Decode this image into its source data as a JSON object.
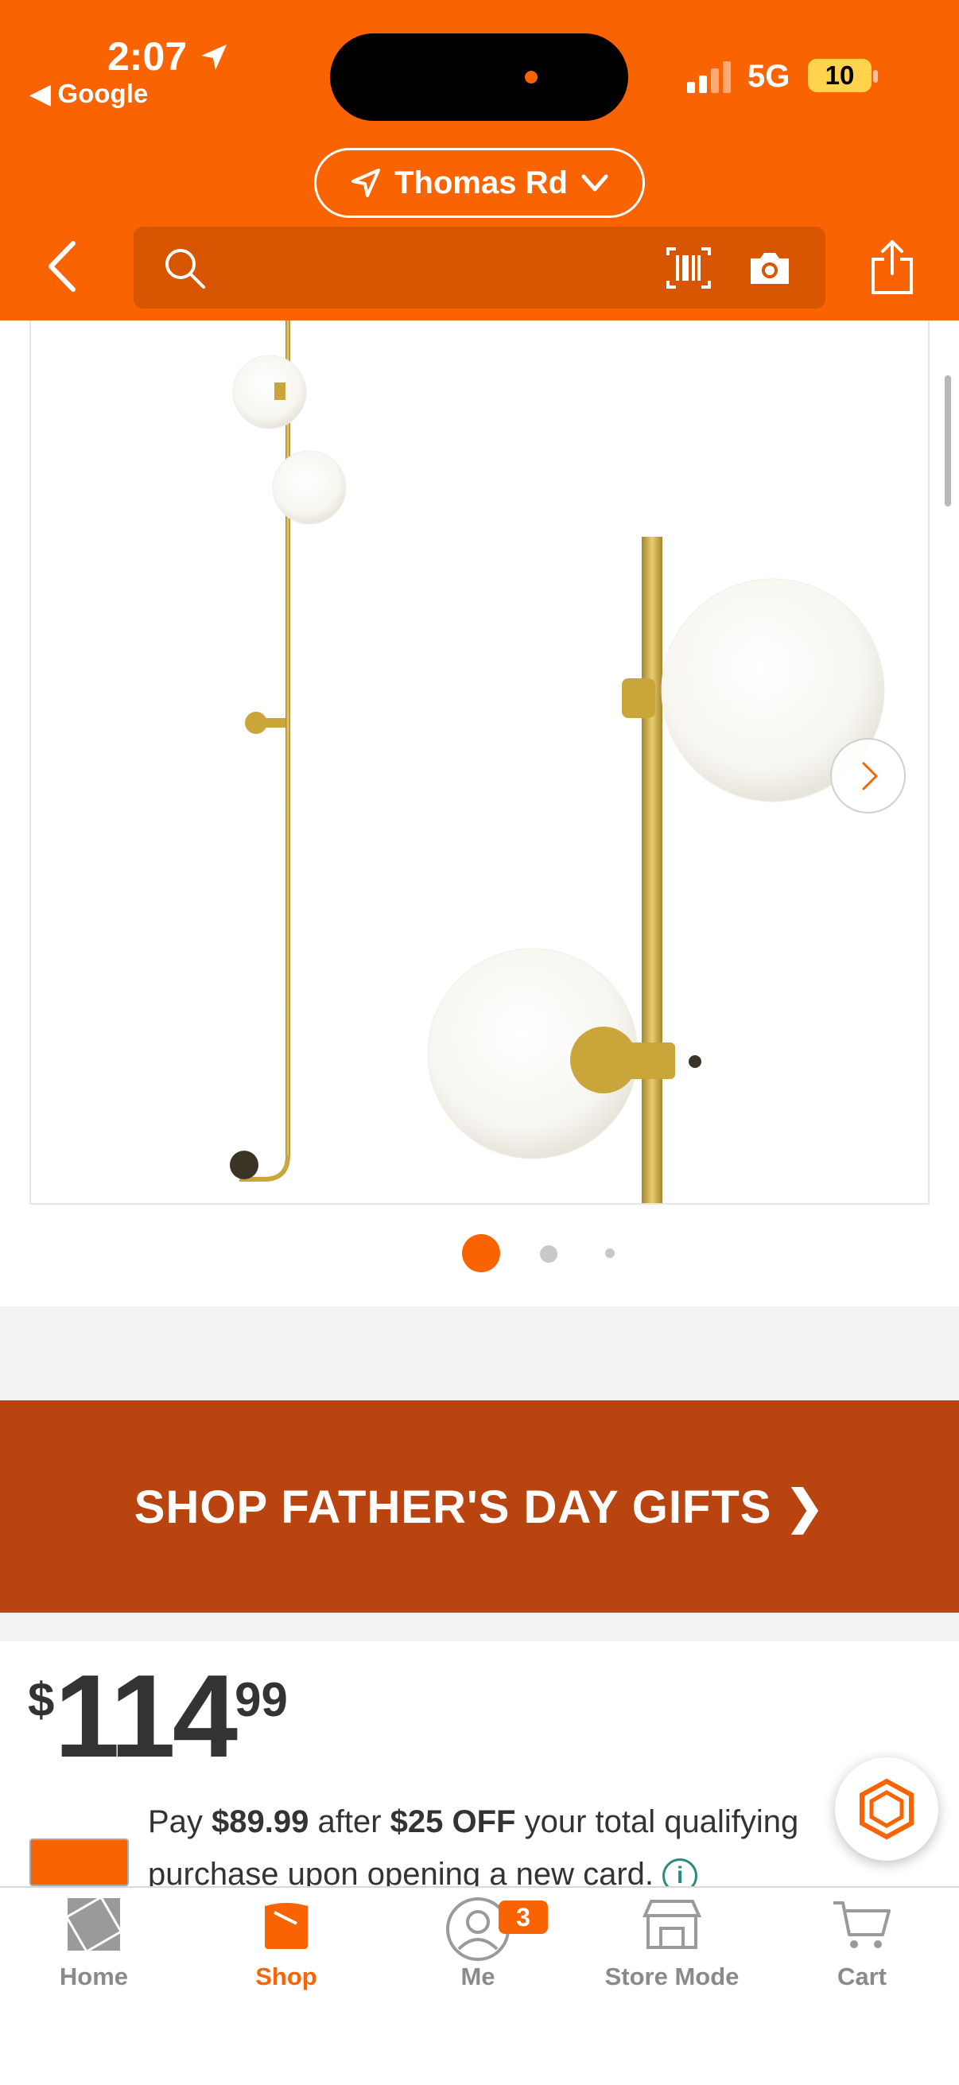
{
  "status_bar": {
    "time": "2:07",
    "back_app": "◀ Google",
    "network": "5G",
    "battery": "10"
  },
  "header": {
    "store_name": "Thomas Rd",
    "search_placeholder": "",
    "icons": [
      "location-arrow-icon",
      "chevron-down-icon",
      "back-icon",
      "search-icon",
      "barcode-icon",
      "camera-icon",
      "share-icon"
    ]
  },
  "gallery": {
    "image_count": 3,
    "active_index": 0,
    "image_alt": "Brass wall sconce with frosted glass globes"
  },
  "promo": {
    "label": "SHOP FATHER'S DAY GIFTS ❯"
  },
  "product": {
    "price_currency": "$",
    "price_dollars": "114",
    "price_cents": "99",
    "offer": {
      "pre": "Pay ",
      "amount": "$89.99",
      "mid": " after ",
      "discount": "$25 OFF",
      "post": " your total qualifying purchase upon opening a new card."
    }
  },
  "tabbar": {
    "items": [
      {
        "label": "Home",
        "icon": "home-depot-logo-icon"
      },
      {
        "label": "Shop",
        "icon": "shop-bucket-icon",
        "active": true
      },
      {
        "label": "Me",
        "icon": "user-icon",
        "badge": "3"
      },
      {
        "label": "Store Mode",
        "icon": "store-icon"
      },
      {
        "label": "Cart",
        "icon": "cart-icon"
      }
    ]
  },
  "colors": {
    "brand_orange": "#f96302",
    "search_bg": "#d85502",
    "promo_bg": "#b94410",
    "brass": "#c9a53a"
  }
}
